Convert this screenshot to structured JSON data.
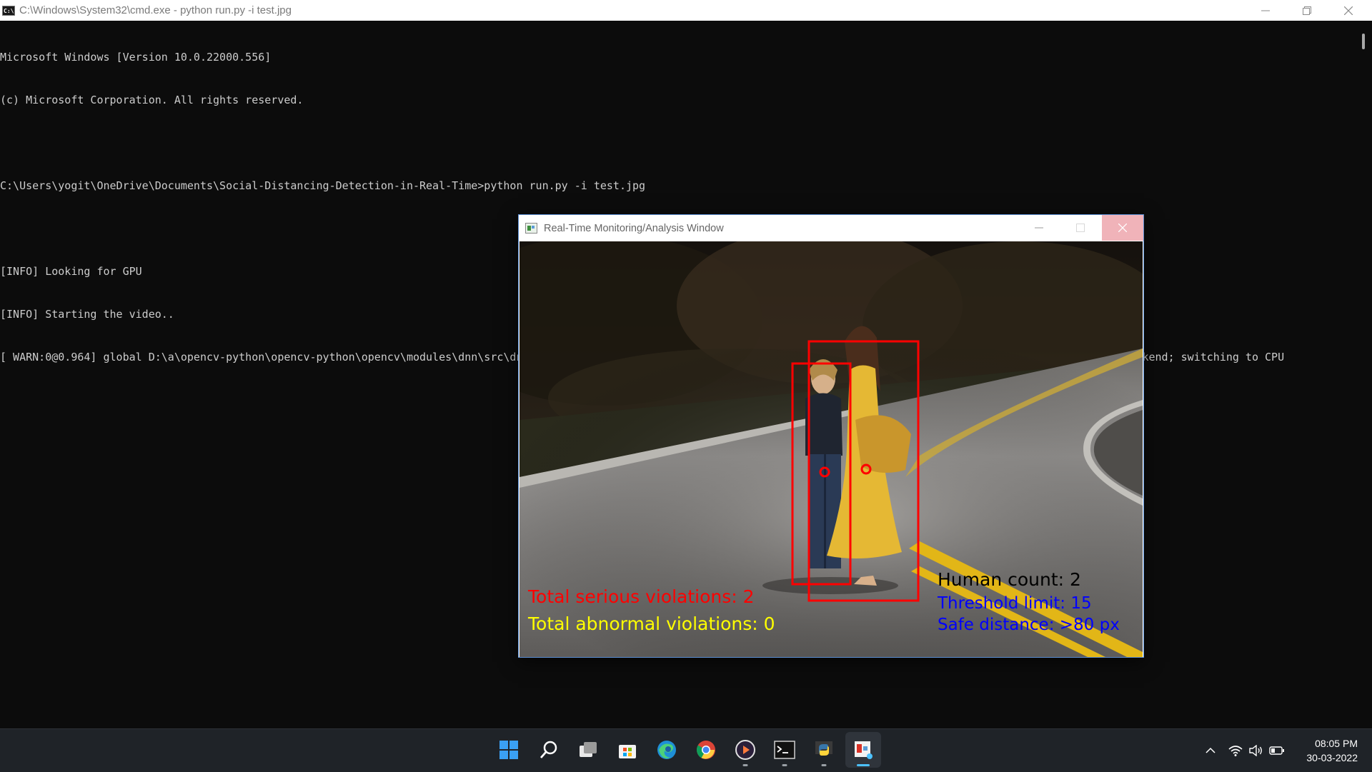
{
  "console_window": {
    "title": "C:\\Windows\\System32\\cmd.exe - python  run.py -i test.jpg",
    "icon": "cmd-icon",
    "controls": [
      "minimize-icon",
      "restore-icon",
      "close-icon"
    ]
  },
  "console": {
    "lines": [
      "Microsoft Windows [Version 10.0.22000.556]",
      "(c) Microsoft Corporation. All rights reserved.",
      "",
      "C:\\Users\\yogit\\OneDrive\\Documents\\Social-Distancing-Detection-in-Real-Time>python run.py -i test.jpg",
      "",
      "[INFO] Looking for GPU",
      "[INFO] Starting the video..",
      "[ WARN:0@0.964] global D:\\a\\opencv-python\\opencv-python\\opencv\\modules\\dnn\\src\\dnn.cpp (1483) cv::dnn::dnn4_v20211220::Net::Impl::setUpNet DNN module was not built with CUDA backend; switching to CPU"
    ]
  },
  "cv_window": {
    "title": "Real-Time Monitoring/Analysis Window",
    "icon": "opencv-window-icon",
    "overlay": {
      "serious": "Total serious violations: 2",
      "abnormal": "Total abnormal violations: 0",
      "count": "Human count: 2",
      "threshold": "Threshold limit: 15",
      "safe": "Safe distance: >80 px"
    },
    "colors": {
      "violation": "#ff0000",
      "abnormal": "#ffff00",
      "info": "#000000",
      "limit": "#0000ff"
    }
  },
  "taskbar": {
    "apps": [
      "start-icon",
      "search-icon",
      "task-view-icon",
      "microsoft-store-icon",
      "edge-icon",
      "chrome-icon",
      "media-player-icon",
      "terminal-icon",
      "python-icon",
      "opencv-app-icon"
    ],
    "tray_icons": [
      "chevron-up-icon",
      "wifi-icon",
      "volume-icon",
      "battery-icon"
    ],
    "time": "08:05 PM",
    "date": "30-03-2022"
  }
}
